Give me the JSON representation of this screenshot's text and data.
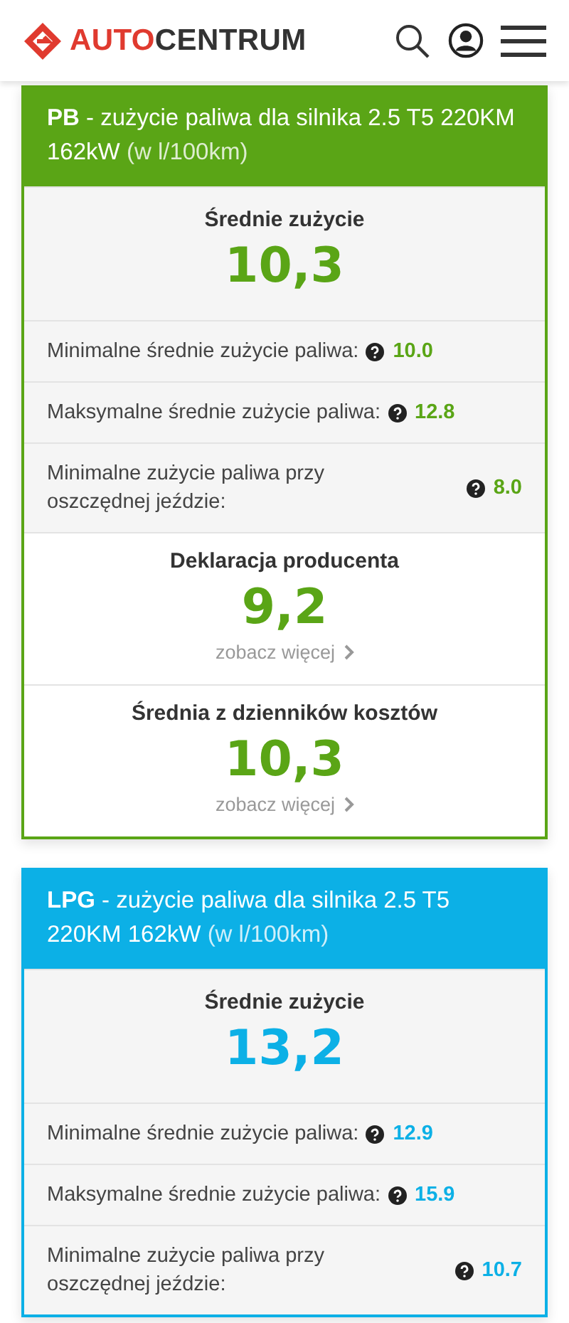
{
  "header": {
    "logo_accent": "AUTO",
    "logo_rest": "CENTRUM"
  },
  "cards": [
    {
      "title": "**PB** - zużycie paliwa dla silnika 2.5 T5 220KM 162kW",
      "unit": "(w l/100km)",
      "color": "#5aa516",
      "sections": [
        {
          "kind": "main",
          "label": "Średnie zużycie",
          "value": "10,3"
        },
        {
          "kind": "stat",
          "label": "Minimalne średnie zużycie paliwa:",
          "value": "10.0"
        },
        {
          "kind": "stat",
          "label": "Maksymalne średnie zużycie paliwa:",
          "value": "12.8"
        },
        {
          "kind": "stat-wide",
          "label": "Minimalne zużycie paliwa przy oszczędnej jeździe:",
          "value": "8.0"
        },
        {
          "kind": "link",
          "label": "Deklaracja producenta",
          "value": "9,2",
          "link": "zobacz więcej"
        },
        {
          "kind": "link",
          "label": "Średnia z dzienników kosztów",
          "value": "10,3",
          "link": "zobacz więcej"
        }
      ]
    },
    {
      "title": "**LPG** - zużycie paliwa dla silnika 2.5 T5 220KM 162kW",
      "unit": "(w l/100km)",
      "color": "#0cb0e6",
      "sections": [
        {
          "kind": "main",
          "label": "Średnie zużycie",
          "value": "13,2"
        },
        {
          "kind": "stat",
          "label": "Minimalne średnie zużycie paliwa:",
          "value": "12.9"
        },
        {
          "kind": "stat",
          "label": "Maksymalne średnie zużycie paliwa:",
          "value": "15.9"
        },
        {
          "kind": "stat-wide",
          "label": "Minimalne zużycie paliwa przy oszczędnej jeździe:",
          "value": "10.7"
        }
      ]
    }
  ]
}
